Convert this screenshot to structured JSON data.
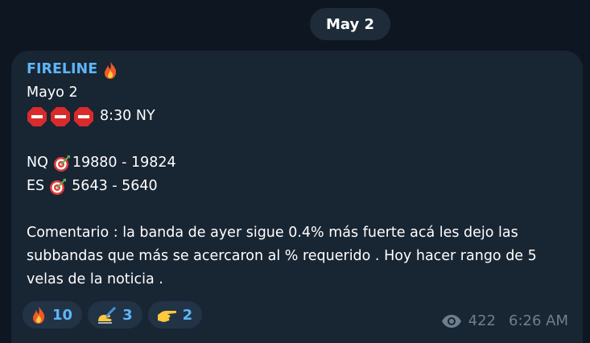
{
  "date_label": "May 2",
  "message": {
    "sender": "FIRELINE",
    "sender_emoji": "fire",
    "lines": {
      "date": "Mayo 2",
      "time_note": "8:30 NY",
      "nq_label": "NQ",
      "nq_value": "19880 - 19824",
      "es_label": "ES",
      "es_value": "5643 - 5640",
      "comment": "Comentario : la banda de ayer sigue 0.4% más fuerte acá les dejo las subbandas que más se acercaron al % requerido . Hoy hacer rango de 5 velas de la noticia ."
    },
    "reactions": [
      {
        "emoji": "fire",
        "count": "10"
      },
      {
        "emoji": "writing-hand",
        "count": "3"
      },
      {
        "emoji": "pointing-hand",
        "count": "2"
      }
    ],
    "views": "422",
    "time": "6:26 AM"
  },
  "colors": {
    "background": "#0e1621",
    "bubble": "#182533",
    "accent": "#5eb5f7",
    "meta": "#6d7f8f"
  }
}
